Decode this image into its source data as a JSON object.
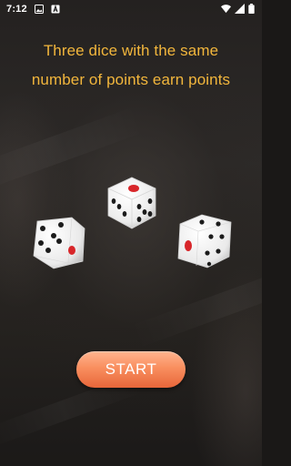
{
  "status_bar": {
    "time": "7:12",
    "icons": [
      "gallery-icon",
      "font-icon"
    ],
    "right_icons": [
      "wifi-icon",
      "signal-icon",
      "battery-icon"
    ]
  },
  "headline": {
    "text": "Three dice with the same number of points earn points",
    "color": "#f2b63c"
  },
  "dice": [
    {
      "name": "die-top",
      "front_face": 5,
      "side_faces": [
        1,
        3
      ]
    },
    {
      "name": "die-left",
      "front_face": 4,
      "side_faces": [
        1
      ]
    },
    {
      "name": "die-right",
      "front_face": 4,
      "side_faces": [
        1
      ]
    }
  ],
  "start_button": {
    "label": "START"
  },
  "colors": {
    "accent_text": "#f2b63c",
    "button_gradient_top": "#ffb48f",
    "button_gradient_bottom": "#e7663a",
    "pip_red": "#d8262a",
    "pip_black": "#1b1b1b"
  }
}
